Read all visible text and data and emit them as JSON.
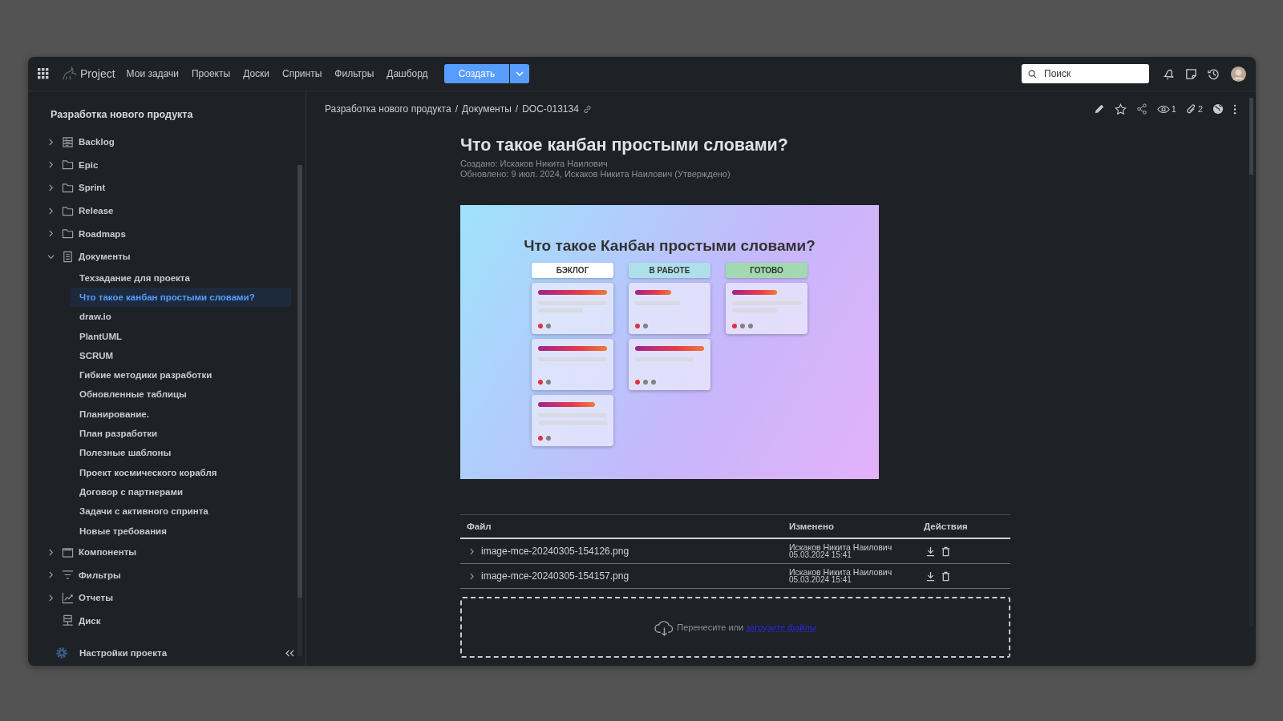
{
  "topbar": {
    "app_name": "Project",
    "nav": [
      "Мои задачи",
      "Проекты",
      "Доски",
      "Спринты",
      "Фильтры",
      "Дашборд"
    ],
    "create_button": "Создать",
    "search": {
      "placeholder": "Поиск"
    }
  },
  "sidebar": {
    "project_title": "Разработка нового продукта",
    "items": [
      {
        "label": "Backlog",
        "kind": "backlog",
        "expanded": false
      },
      {
        "label": "Epic",
        "kind": "folder",
        "expanded": false
      },
      {
        "label": "Sprint",
        "kind": "folder",
        "expanded": false
      },
      {
        "label": "Release",
        "kind": "folder",
        "expanded": false
      },
      {
        "label": "Roadmaps",
        "kind": "folder",
        "expanded": false
      },
      {
        "label": "Документы",
        "kind": "document",
        "expanded": true,
        "children": [
          {
            "label": "Техзадание для проекта",
            "selected": false
          },
          {
            "label": "Что такое канбан простыми словами?",
            "selected": true
          },
          {
            "label": "draw.io",
            "selected": false
          },
          {
            "label": "PlantUML",
            "selected": false
          },
          {
            "label": "SCRUM",
            "selected": false
          },
          {
            "label": "Гибкие методики разработки",
            "selected": false
          },
          {
            "label": "Обновленные таблицы",
            "selected": false
          },
          {
            "label": "Планирование.",
            "selected": false
          },
          {
            "label": "План разработки",
            "selected": false
          },
          {
            "label": "Полезные шаблоны",
            "selected": false
          },
          {
            "label": "Проект космического корабля",
            "selected": false
          },
          {
            "label": "Договор с партнерами",
            "selected": false
          },
          {
            "label": "Задачи с активного спринта",
            "selected": false
          },
          {
            "label": "Новые требования",
            "selected": false
          }
        ]
      },
      {
        "label": "Компоненты",
        "kind": "components",
        "expanded": false
      },
      {
        "label": "Фильтры",
        "kind": "filters",
        "expanded": false
      },
      {
        "label": "Отчеты",
        "kind": "reports",
        "expanded": false
      },
      {
        "label": "Диск",
        "kind": "disk"
      }
    ],
    "settings_label": "Настройки проекта"
  },
  "page": {
    "breadcrumb": [
      "Разработка нового продукта",
      "Документы",
      "DOC-013134"
    ],
    "breadcrumb_separator": "/",
    "watchers_count": "1",
    "attachments_count": "2",
    "title": "Что такое канбан простыми словами?",
    "created": "Создано: Искаков Никита Наилович",
    "updated": "Обновлено: 9 июл. 2024, Искаков Никита Наилович  (Утверждено)",
    "illustration": {
      "title": "Что такое Канбан простыми словами?",
      "columns": [
        {
          "label": "БЭКЛОГ",
          "color": "#ffffff"
        },
        {
          "label": "В РАБОТЕ",
          "color": "#aee0ec"
        },
        {
          "label": "ГОТОВО",
          "color": "#a3d9b1"
        }
      ]
    },
    "attachments": {
      "columns": [
        "Файл",
        "Изменено",
        "Действия"
      ],
      "rows": [
        {
          "file": "image-mce-20240305-154126.png",
          "author": "Искаков Никита Наилович",
          "date": "05.03.2024 15:41",
          "expanded": false
        },
        {
          "file": "image-mce-20240305-154157.png",
          "author": "Искаков Никита Наилович",
          "date": "05.03.2024 15:41",
          "expanded": false
        }
      ]
    },
    "dropzone": {
      "text": "Перенесите или",
      "link": "загрузите файлы"
    }
  }
}
